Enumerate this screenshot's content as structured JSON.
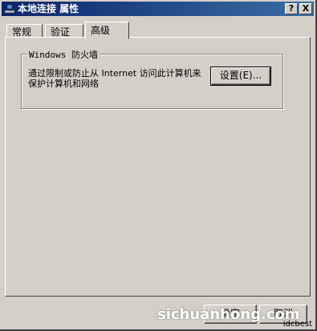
{
  "window": {
    "title": "本地连接 属性",
    "help_label": "?",
    "close_label": "X"
  },
  "tabs": [
    {
      "label": "常规"
    },
    {
      "label": "验证"
    },
    {
      "label": "高级"
    }
  ],
  "firewall": {
    "group_title": "Windows 防火墙",
    "description": "通过限制或防止从 Internet 访问此计算机来保护计算机和网络",
    "settings_label": "设置(E)..."
  },
  "footer": {
    "ok_label": "确定",
    "cancel_label": "取消"
  },
  "watermark": "sichuanhong.com",
  "corner_text": "idcbest"
}
